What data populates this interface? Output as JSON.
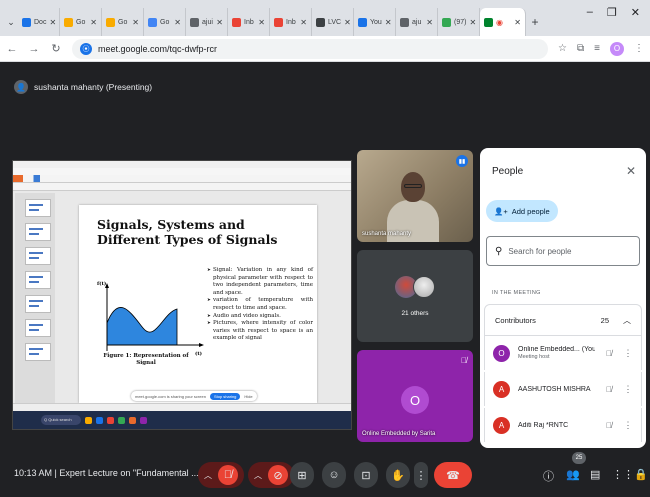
{
  "browser": {
    "tabs": [
      {
        "label": "Doc",
        "color": "#1a73e8"
      },
      {
        "label": "Go",
        "color": "#f9ab00"
      },
      {
        "label": "Go",
        "color": "#f9ab00"
      },
      {
        "label": "Go",
        "color": "#4285f4"
      },
      {
        "label": "ajui",
        "color": "#5f6368"
      },
      {
        "label": "Inb",
        "color": "#ea4335"
      },
      {
        "label": "Inb",
        "color": "#ea4335"
      },
      {
        "label": "LVC",
        "color": "#3c4043"
      },
      {
        "label": "You",
        "color": "#1a73e8"
      },
      {
        "label": "aju",
        "color": "#5f6368"
      },
      {
        "label": "(97)",
        "color": "#34a853"
      }
    ],
    "url": "meet.google.com/tqc-dwfp-rcr"
  },
  "meet": {
    "presenter_text": "sushanta mahanty (Presenting)",
    "meeting_time": "10:13 AM",
    "meeting_title": "Expert Lecture on \"Fundamental ...",
    "participant_count_badge": "25"
  },
  "slide": {
    "title": "Signals, Systems and Different Types of Signals",
    "figure_caption": "Figure 1: Representation of Signal",
    "axis_y": "f(t)",
    "axis_x": "(t)",
    "bullets": [
      "Signal: Variation in any kind of physical parameter with respect to two independent parameters, time and space.",
      "variation of temperature with respect to time and space.",
      "Audio and video signals.",
      "Pictures, where intensity of color varies with respect to space is an example of signal"
    ]
  },
  "tiles": {
    "camera_name": "sushanta mahanty",
    "others_label": "21 others",
    "self_initial": "O",
    "self_name": "Online Embedded by Sarita"
  },
  "people_panel": {
    "title": "People",
    "add_people": "Add people",
    "search_placeholder": "Search for people",
    "section": "IN THE MEETING",
    "group_name": "Contributors",
    "group_count": "25",
    "participants": [
      {
        "initial": "O",
        "name": "Online Embedded... (You)",
        "role": "Meeting host",
        "color": "#8e24aa"
      },
      {
        "initial": "A",
        "name": "AASHUTOSH MISHRA",
        "role": "",
        "color": "#d93025"
      },
      {
        "initial": "A",
        "name": "Aditi Raj *RNTC",
        "role": "",
        "color": "#d93025"
      }
    ]
  },
  "colors": {
    "meet_bg": "#202124",
    "accent_blue": "#1a73e8",
    "end_call_red": "#ea4335",
    "signal_fill": "#2e86de"
  }
}
